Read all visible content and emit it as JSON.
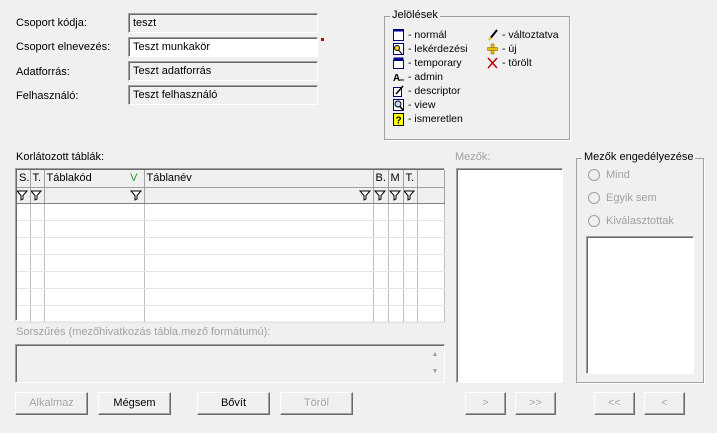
{
  "form": {
    "code_label": "Csoport kódja:",
    "code_value": "teszt",
    "name_label": "Csoport elnevezés:",
    "name_value": "Teszt munkakör",
    "source_label": "Adatforrás:",
    "source_value": "Teszt adatforrás",
    "user_label": "Felhasználó:",
    "user_value": "Teszt felhasználó"
  },
  "legend": {
    "title": "Jelölések",
    "left": [
      {
        "icon": "normal-icon",
        "label": "- normál"
      },
      {
        "icon": "query-icon",
        "label": "- lekérdezési"
      },
      {
        "icon": "temporary-icon",
        "label": "- temporary"
      },
      {
        "icon": "admin-icon",
        "label": "- admin"
      },
      {
        "icon": "descriptor-icon",
        "label": "- descriptor"
      },
      {
        "icon": "view-icon",
        "label": "- view"
      },
      {
        "icon": "unknown-icon",
        "label": "- ismeretlen"
      }
    ],
    "right": [
      {
        "icon": "pencil-icon",
        "label": "- változtatva"
      },
      {
        "icon": "plus-icon",
        "label": "- új"
      },
      {
        "icon": "cross-icon",
        "label": "- törölt"
      }
    ]
  },
  "tables": {
    "label": "Korlátozott táblák:",
    "columns": [
      "S.",
      "T.",
      "Táblakód",
      "Táblanév",
      "B.",
      "M",
      "T."
    ],
    "rows": []
  },
  "fields": {
    "label": "Mezők:"
  },
  "permission": {
    "title": "Mezők engedélyezése",
    "options": [
      "Mind",
      "Egyik sem",
      "Kiválasztottak"
    ]
  },
  "sort_filter": {
    "label": "Sorszűrés (mezőhivatkozás tábla.mező formátumú):"
  },
  "buttons": {
    "apply": "Alkalmaz",
    "cancel": "Mégsem",
    "expand": "Bővít",
    "delete": "Töröl",
    "move_right": ">",
    "move_all_right": ">>",
    "move_all_left": "<<",
    "move_left": "<"
  },
  "colors": {
    "background": "#f0f0f0",
    "required_marker": "#c00000",
    "sort_indicator": "#1ea01e",
    "disabled_text": "#a0a0a0"
  }
}
